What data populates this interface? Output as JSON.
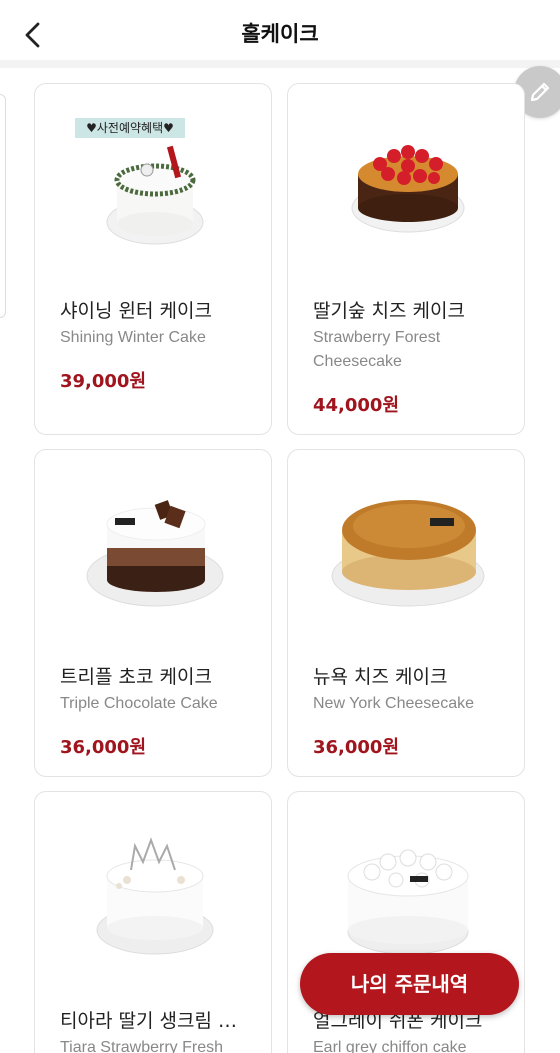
{
  "header": {
    "title": "홀케이크",
    "back_icon": "chevron-left-icon"
  },
  "fab": {
    "icon": "pencil-icon"
  },
  "products": [
    {
      "name_ko": "샤이닝 윈터 케이크",
      "name_en": "Shining Winter Cake",
      "price": "39,000원",
      "badge": "♥사전예약혜택♥"
    },
    {
      "name_ko": "딸기숲 치즈 케이크",
      "name_en": "Strawberry Forest Cheesecake",
      "price": "44,000원"
    },
    {
      "name_ko": "트리플 초코 케이크",
      "name_en": "Triple Chocolate Cake",
      "price": "36,000원"
    },
    {
      "name_ko": "뉴욕 치즈 케이크",
      "name_en": "New York Cheesecake",
      "price": "36,000원"
    },
    {
      "name_ko": "티아라 딸기 생크림 …",
      "name_en": "Tiara Strawberry Fresh",
      "price": ""
    },
    {
      "name_ko": "얼그레이 쉬폰 케이크",
      "name_en": "Earl grey chiffon cake",
      "price": ""
    }
  ],
  "order_button": {
    "label": "나의 주문내역"
  },
  "colors": {
    "price": "#a0141e",
    "order_button": "#b3161d"
  }
}
